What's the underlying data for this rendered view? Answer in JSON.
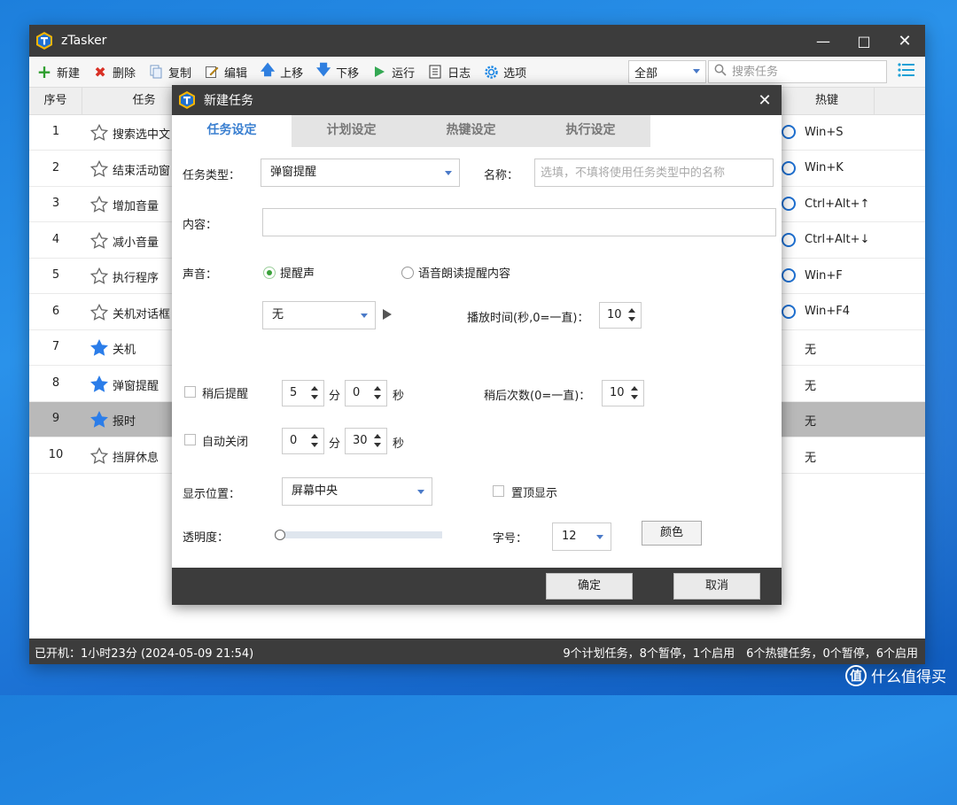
{
  "app": {
    "title": "zTasker"
  },
  "window_controls": {
    "minimize": "—",
    "maximize": "□",
    "close": "✕"
  },
  "toolbar": {
    "new": "新建",
    "delete": "删除",
    "copy": "复制",
    "edit": "编辑",
    "move_up": "上移",
    "move_down": "下移",
    "run": "运行",
    "log": "日志",
    "options": "选项",
    "filter_value": "全部",
    "search_placeholder": "搜索任务"
  },
  "table": {
    "headers": {
      "index": "序号",
      "task": "任务",
      "hotkey": "热键"
    },
    "rows": [
      {
        "index": "1",
        "name": "搜索选中文",
        "starred": false,
        "hotkey": "Win+S",
        "enabled_ring": true
      },
      {
        "index": "2",
        "name": "结束活动窗",
        "starred": false,
        "hotkey": "Win+K",
        "enabled_ring": true
      },
      {
        "index": "3",
        "name": "增加音量",
        "starred": false,
        "hotkey": "Ctrl+Alt+↑",
        "enabled_ring": true
      },
      {
        "index": "4",
        "name": "减小音量",
        "starred": false,
        "hotkey": "Ctrl+Alt+↓",
        "enabled_ring": true
      },
      {
        "index": "5",
        "name": "执行程序",
        "starred": false,
        "hotkey": "Win+F",
        "enabled_ring": true
      },
      {
        "index": "6",
        "name": "关机对话框",
        "starred": false,
        "hotkey": "Win+F4",
        "enabled_ring": true
      },
      {
        "index": "7",
        "name": "关机",
        "starred": true,
        "hotkey": "无",
        "enabled_ring": false
      },
      {
        "index": "8",
        "name": "弹窗提醒",
        "starred": true,
        "hotkey": "无",
        "enabled_ring": false
      },
      {
        "index": "9",
        "name": "报时",
        "starred": true,
        "hotkey": "无",
        "enabled_ring": false,
        "selected": true
      },
      {
        "index": "10",
        "name": "挡屏休息",
        "starred": false,
        "hotkey": "无",
        "enabled_ring": false
      }
    ]
  },
  "statusbar": {
    "left": "已开机：1小时23分 (2024-05-09 21:54)",
    "right": "9个计划任务，8个暂停，1个启用　6个热键任务，0个暂停，6个启用"
  },
  "dialog": {
    "title": "新建任务",
    "close": "✕",
    "tabs": [
      "任务设定",
      "计划设定",
      "热键设定",
      "执行设定"
    ],
    "active_tab": 0,
    "task_type_label": "任务类型：",
    "task_type_value": "弹窗提醒",
    "name_label": "名称：",
    "name_placeholder": "选填，不填将使用任务类型中的名称",
    "content_label": "内容：",
    "content_value": "",
    "sound_label": "声音：",
    "radio_alarm": "提醒声",
    "radio_tts": "语音朗读提醒内容",
    "sound_value": "无",
    "play_time_label": "播放时间(秒,0=一直)：",
    "play_time_value": "10",
    "snooze_label": "稍后提醒",
    "snooze_min": "5",
    "snooze_sec": "0",
    "unit_min": "分",
    "unit_sec": "秒",
    "snooze_count_label": "稍后次数(0=一直)：",
    "snooze_count_value": "10",
    "autoclose_label": "自动关闭",
    "autoclose_min": "0",
    "autoclose_sec": "30",
    "position_label": "显示位置：",
    "position_value": "屏幕中央",
    "topmost_label": "置顶显示",
    "opacity_label": "透明度：",
    "opacity_level": 0,
    "font_size_label": "字号：",
    "font_size_value": "12",
    "color_button": "颜色",
    "ok": "确定",
    "cancel": "取消"
  },
  "watermark": {
    "text": "什么值得买",
    "badge": "值"
  },
  "colors": {
    "accent": "#1e6fd0",
    "titlebar": "#3c3c3c",
    "star": "#2b7de9",
    "selected_row": "#b9b9b9"
  }
}
